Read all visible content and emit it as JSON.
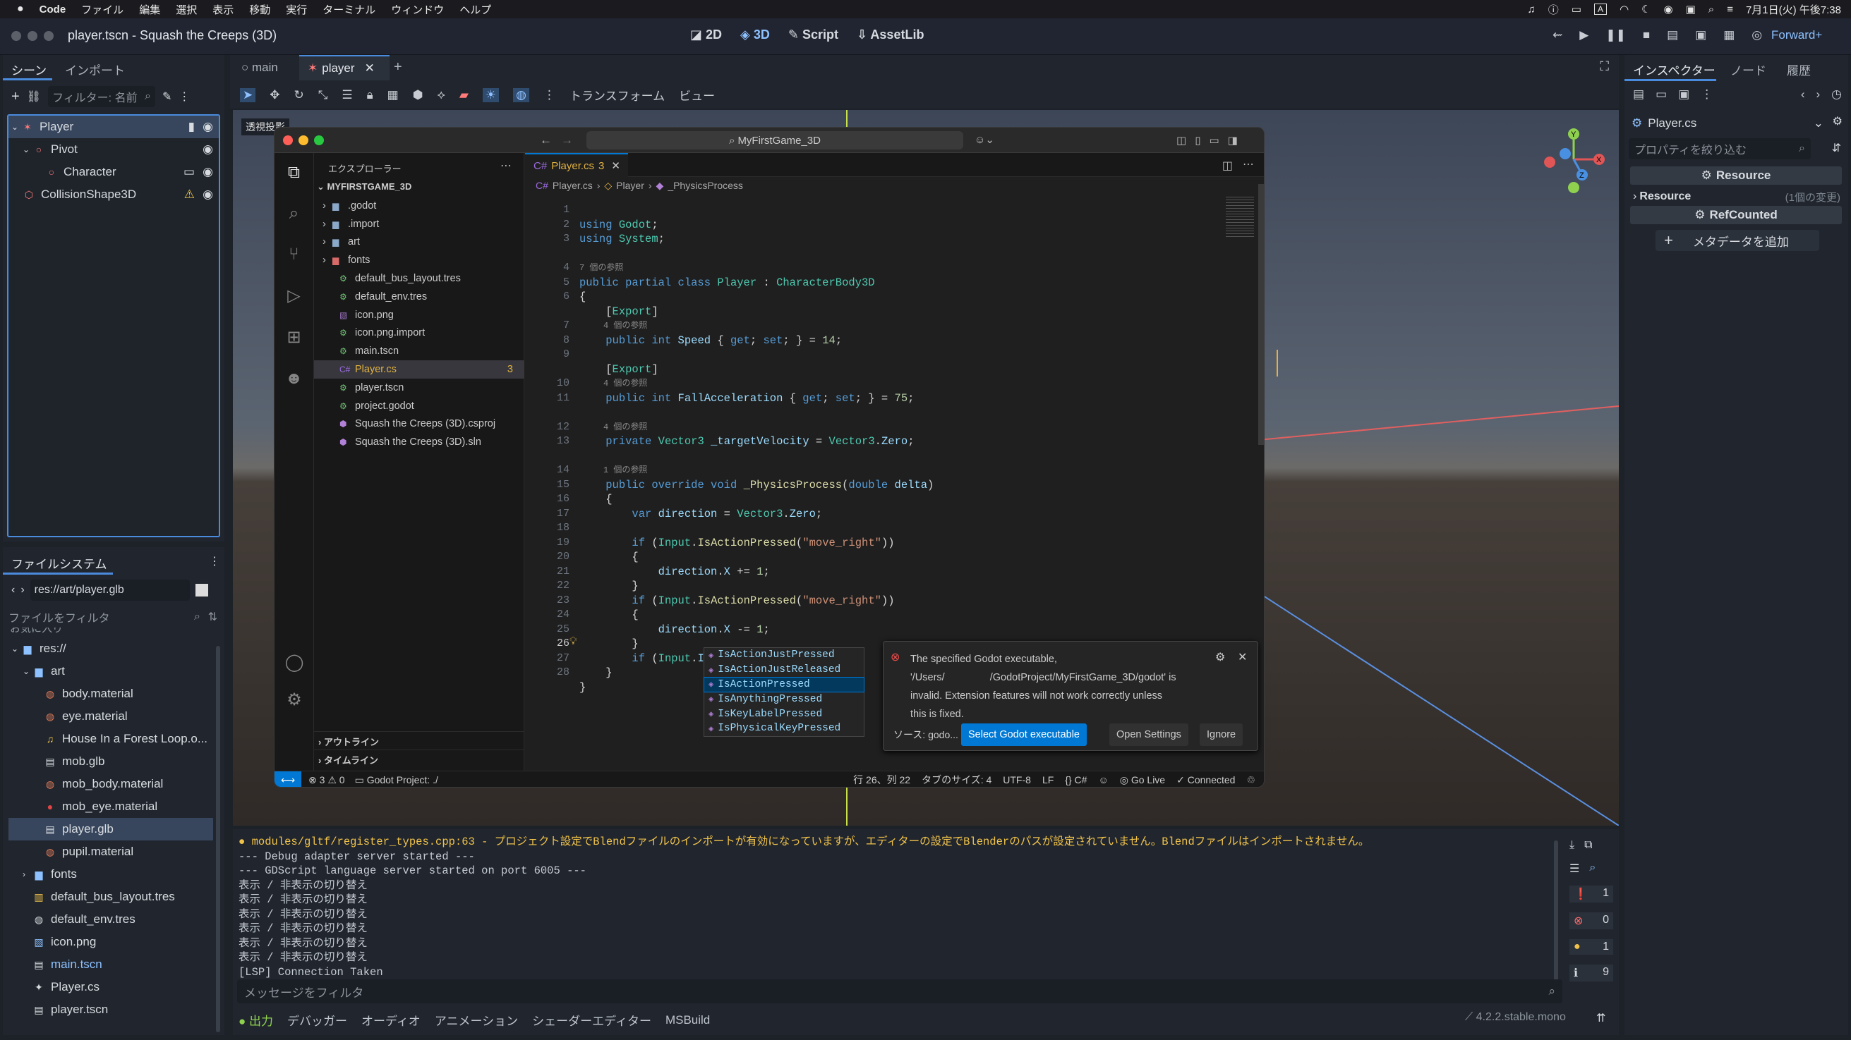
{
  "menubar": {
    "app": "Code",
    "items": [
      "ファイル",
      "編集",
      "選択",
      "表示",
      "移動",
      "実行",
      "ターミナル",
      "ウィンドウ",
      "ヘルプ"
    ],
    "clock": "7月1日(火) 午後7:38",
    "input_indicator": "A"
  },
  "godot": {
    "title": "player.tscn - Squash the Creeps (3D)",
    "modes": [
      "2D",
      "3D",
      "Script",
      "AssetLib"
    ],
    "renderer": "Forward+",
    "scene_dock": {
      "tabs": [
        "シーン",
        "インポート"
      ],
      "filter_placeholder": "フィルター: 名前",
      "nodes": [
        "Player",
        "Pivot",
        "Character",
        "CollisionShape3D"
      ]
    },
    "editor_tabs": [
      "main",
      "player"
    ],
    "toolbar": {
      "transform": "トランスフォーム",
      "view": "ビュー"
    },
    "viewport_label": "透視投影",
    "filesystem": {
      "title": "ファイルシステム",
      "path": "res://art/player.glb",
      "filter_placeholder": "ファイルをフィルタ",
      "partial_top": "お気に入り",
      "items": [
        {
          "name": "res://",
          "indent": 0,
          "icon": "folder"
        },
        {
          "name": "art",
          "indent": 1,
          "icon": "folder"
        },
        {
          "name": "body.material",
          "indent": 2,
          "icon": "material"
        },
        {
          "name": "eye.material",
          "indent": 2,
          "icon": "material"
        },
        {
          "name": "House In a Forest Loop.o...",
          "indent": 2,
          "icon": "audio"
        },
        {
          "name": "mob.glb",
          "indent": 2,
          "icon": "scene"
        },
        {
          "name": "mob_body.material",
          "indent": 2,
          "icon": "material"
        },
        {
          "name": "mob_eye.material",
          "indent": 2,
          "icon": "material-red"
        },
        {
          "name": "player.glb",
          "indent": 2,
          "icon": "scene",
          "selected": true
        },
        {
          "name": "pupil.material",
          "indent": 2,
          "icon": "material"
        },
        {
          "name": "fonts",
          "indent": 1,
          "icon": "folder"
        },
        {
          "name": "default_bus_layout.tres",
          "indent": 1,
          "icon": "bus"
        },
        {
          "name": "default_env.tres",
          "indent": 1,
          "icon": "env"
        },
        {
          "name": "icon.png",
          "indent": 1,
          "icon": "image"
        },
        {
          "name": "main.tscn",
          "indent": 1,
          "icon": "scene",
          "link": true
        },
        {
          "name": "Player.cs",
          "indent": 1,
          "icon": "script"
        },
        {
          "name": "player.tscn",
          "indent": 1,
          "icon": "scene"
        }
      ]
    },
    "inspector": {
      "tabs": [
        "インスペクター",
        "ノード",
        "履歴"
      ],
      "file": "Player.cs",
      "filter_placeholder": "プロパティを絞り込む",
      "resource_header": "Resource",
      "resource_row": "Resource",
      "resource_note": "(1個の変更)",
      "refcounted": "RefCounted",
      "add_meta": "メタデータを追加"
    },
    "output": {
      "lines": [
        "● modules/gltf/register_types.cpp:63 - プロジェクト設定でBlendファイルのインポートが有効になっていますが、エディターの設定でBlenderのパスが設定されていません。Blendファイルはインポートされません。",
        "--- Debug adapter server started ---",
        "--- GDScript language server started on port 6005 ---",
        "表示 / 非表示の切り替え",
        "表示 / 非表示の切り替え",
        "表示 / 非表示の切り替え",
        "表示 / 非表示の切り替え",
        "表示 / 非表示の切り替え",
        "表示 / 非表示の切り替え",
        "[LSP] Connection Taken"
      ],
      "filter_placeholder": "メッセージをフィルタ",
      "counts": [
        "1",
        "0",
        "1",
        "9"
      ]
    },
    "bottom_tabs": [
      "出力",
      "デバッガー",
      "オーディオ",
      "アニメーション",
      "シェーダーエディター",
      "MSBuild"
    ],
    "version": "4.2.2.stable.mono"
  },
  "vscode": {
    "search": "MyFirstGame_3D",
    "explorer_title": "エクスプローラー",
    "project": "MYFIRSTGAME_3D",
    "files": [
      {
        "name": ".godot",
        "type": "folder"
      },
      {
        "name": ".import",
        "type": "folder"
      },
      {
        "name": "art",
        "type": "folder"
      },
      {
        "name": "fonts",
        "type": "folder-red"
      },
      {
        "name": "default_bus_layout.tres",
        "type": "gd"
      },
      {
        "name": "default_env.tres",
        "type": "gd"
      },
      {
        "name": "icon.png",
        "type": "img"
      },
      {
        "name": "icon.png.import",
        "type": "gd"
      },
      {
        "name": "main.tscn",
        "type": "gd"
      },
      {
        "name": "Player.cs",
        "type": "cs",
        "badge": "3",
        "active": true
      },
      {
        "name": "player.tscn",
        "type": "gd"
      },
      {
        "name": "project.godot",
        "type": "gd"
      },
      {
        "name": "Squash the Creeps (3D).csproj",
        "type": "proj"
      },
      {
        "name": "Squash the Creeps (3D).sln",
        "type": "proj"
      }
    ],
    "outline": "アウトライン",
    "timeline": "タイムライン",
    "tab": "Player.cs",
    "tab_badge": "3",
    "breadcrumb": [
      "Player.cs",
      "Player",
      "_PhysicsProcess"
    ],
    "refs": {
      "r7": "7 個の参照",
      "r4": "4 個の参照",
      "r1": "1 個の参照"
    },
    "autocomplete": [
      "IsActionJustPressed",
      "IsActionJustReleased",
      "IsActionPressed",
      "IsAnythingPressed",
      "IsKeyLabelPressed",
      "IsPhysicalKeyPressed"
    ],
    "notification": {
      "l1": "The specified Godot executable,",
      "l2a": "'/Users/",
      "l2b": "/GodotProject/MyFirstGame_3D/godot' is",
      "l3": "invalid. Extension features will not work correctly unless",
      "l4": "this is fixed.",
      "source": "ソース: godo...",
      "primary": "Select Godot executable",
      "settings": "Open Settings",
      "ignore": "Ignore"
    },
    "status": {
      "problems": "3",
      "warnings": "0",
      "project": "Godot Project: ./",
      "pos": "行 26、列 22",
      "tab": "タブのサイズ: 4",
      "enc": "UTF-8",
      "eol": "LF",
      "lang": "C#",
      "golive": "Go Live",
      "conn": "Connected"
    }
  }
}
